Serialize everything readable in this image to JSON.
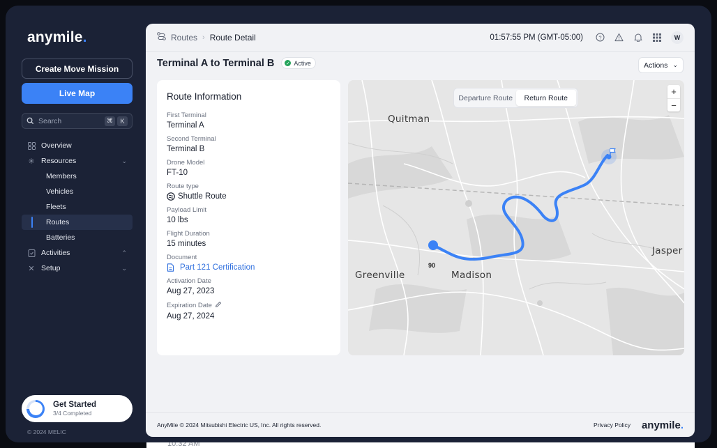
{
  "brand": {
    "logo_main": "anymile",
    "logo_dot": "."
  },
  "sidebar": {
    "create_button": "Create Move Mission",
    "live_map_button": "Live Map",
    "search": {
      "placeholder": "Search",
      "shortcut_1": "⌘",
      "shortcut_2": "K"
    },
    "nav": {
      "overview": "Overview",
      "resources": "Resources",
      "members": "Members",
      "vehicles": "Vehicles",
      "fleets": "Fleets",
      "routes": "Routes",
      "batteries": "Batteries",
      "activities": "Activities",
      "setup": "Setup"
    },
    "get_started": {
      "title": "Get Started",
      "progress": "3/4 Completed",
      "fraction": 0.75
    },
    "copyright": "© 2024 MELIC"
  },
  "topbar": {
    "breadcrumb_root": "Routes",
    "breadcrumb_current": "Route Detail",
    "clock": "01:57:55 PM (GMT-05:00)",
    "avatar_initial": "W"
  },
  "page": {
    "title": "Terminal A to Terminal B",
    "status": "Active",
    "actions_label": "Actions"
  },
  "route_info": {
    "heading": "Route Information",
    "first_terminal_label": "First Terminal",
    "first_terminal": "Terminal A",
    "second_terminal_label": "Second Terminal",
    "second_terminal": "Terminal B",
    "drone_model_label": "Drone Model",
    "drone_model": "FT-10",
    "route_type_label": "Route type",
    "route_type": "Shuttle Route",
    "payload_label": "Payload Limit",
    "payload": "10 lbs",
    "duration_label": "Flight Duration",
    "duration": "15 minutes",
    "document_label": "Document",
    "document": "Part 121 Certification",
    "activation_label": "Activation Date",
    "activation": "Aug 27, 2023",
    "expiration_label": "Expiration Date",
    "expiration": "Aug 27, 2024"
  },
  "map": {
    "tab_departure": "Departure Route",
    "tab_return": "Return Route",
    "zoom_in": "+",
    "zoom_out": "−",
    "cities": {
      "quitman": "Quitman",
      "greenville": "Greenville",
      "madison": "Madison",
      "jasper": "Jasper"
    },
    "highway_90": "90",
    "route_color": "#3b82f6"
  },
  "footer": {
    "copyright": "AnyMile © 2024 Mitsubishi Electric US, Inc. All rights reserved.",
    "privacy": "Privacy Policy"
  },
  "peek_text": "10:32 AM"
}
